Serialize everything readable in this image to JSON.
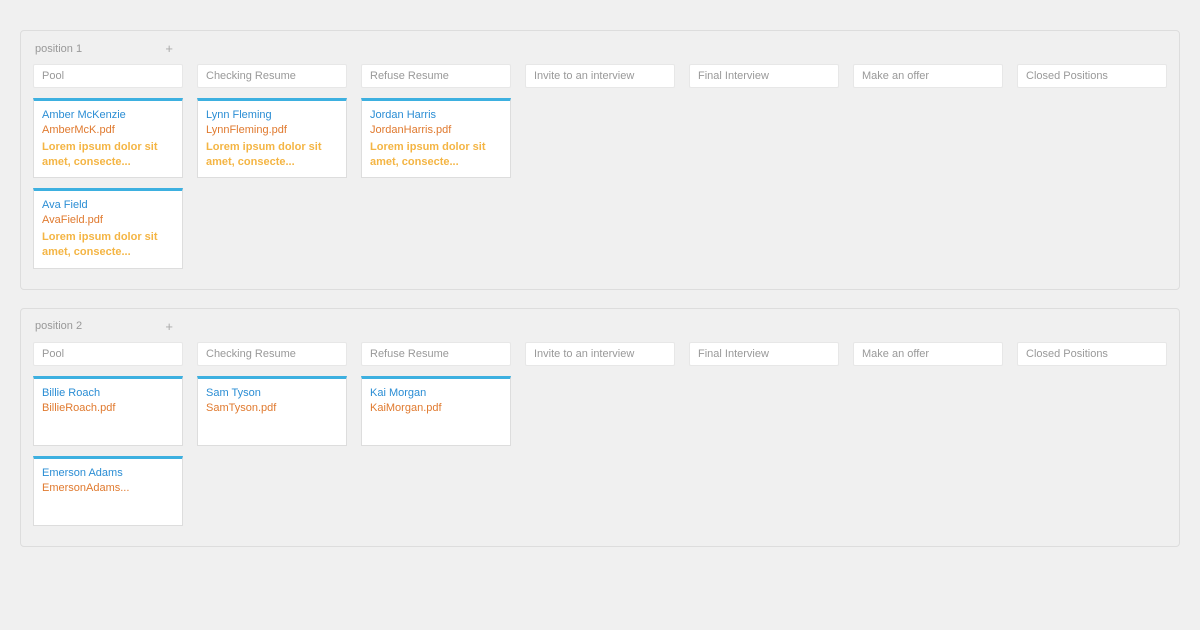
{
  "positions": [
    {
      "title": "position 1",
      "columns": [
        {
          "label": "Pool",
          "cards": [
            {
              "name": "Amber McKenzie",
              "file": "AmberMcK.pdf",
              "desc": "Lorem ipsum dolor sit amet, consecte..."
            },
            {
              "name": "Ava Field",
              "file": "AvaField.pdf",
              "desc": "Lorem ipsum dolor sit amet, consecte..."
            }
          ]
        },
        {
          "label": "Checking Resume",
          "cards": [
            {
              "name": "Lynn Fleming",
              "file": "LynnFleming.pdf",
              "desc": "Lorem ipsum dolor sit amet, consecte..."
            }
          ]
        },
        {
          "label": "Refuse Resume",
          "cards": [
            {
              "name": "Jordan Harris",
              "file": "JordanHarris.pdf",
              "desc": "Lorem ipsum dolor sit amet, consecte..."
            }
          ]
        },
        {
          "label": "Invite to an interview",
          "cards": []
        },
        {
          "label": "Final Interview",
          "cards": []
        },
        {
          "label": "Make an offer",
          "cards": []
        },
        {
          "label": "Closed Positions",
          "cards": []
        }
      ]
    },
    {
      "title": "position 2",
      "columns": [
        {
          "label": "Pool",
          "cards": [
            {
              "name": "Billie Roach",
              "file": "BillieRoach.pdf",
              "desc": ""
            },
            {
              "name": "Emerson Adams",
              "file": "EmersonAdams...",
              "desc": ""
            }
          ]
        },
        {
          "label": "Checking Resume",
          "cards": [
            {
              "name": "Sam Tyson",
              "file": "SamTyson.pdf",
              "desc": ""
            }
          ]
        },
        {
          "label": "Refuse Resume",
          "cards": [
            {
              "name": "Kai Morgan",
              "file": "KaiMorgan.pdf",
              "desc": ""
            }
          ]
        },
        {
          "label": "Invite to an interview",
          "cards": []
        },
        {
          "label": "Final Interview",
          "cards": []
        },
        {
          "label": "Make an offer",
          "cards": []
        },
        {
          "label": "Closed Positions",
          "cards": []
        }
      ]
    }
  ],
  "plus_icon": "+"
}
